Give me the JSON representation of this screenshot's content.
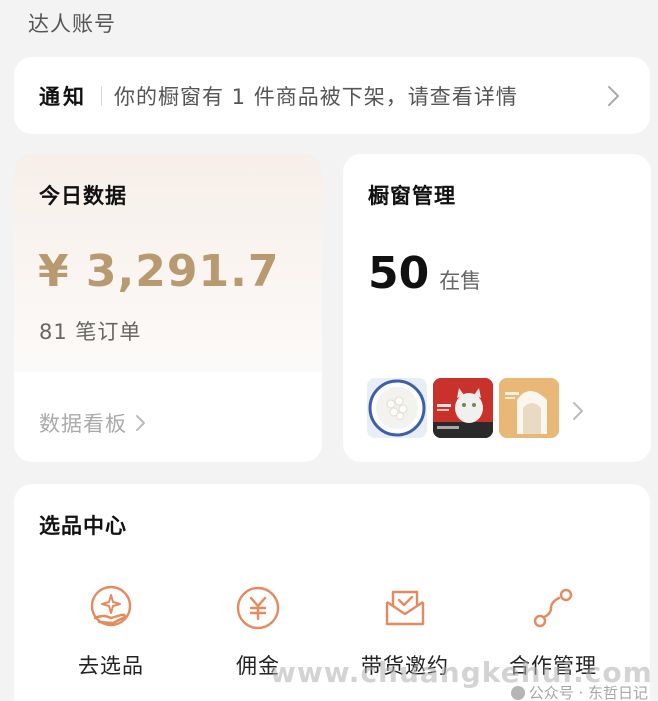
{
  "account": {
    "label": "达人账号"
  },
  "notice": {
    "tag": "通知",
    "text": "你的橱窗有 1 件商品被下架，请查看详情",
    "chevron_icon": "chevron-right-icon"
  },
  "today": {
    "title": "今日数据",
    "amount": "¥ 3,291.7",
    "orders": "81 笔订单",
    "dashboard_link": "数据看板",
    "accent_color": "#b89a71"
  },
  "window": {
    "title": "橱窗管理",
    "count": "50",
    "unit": "在售",
    "thumbnails": [
      "product-thumb-bowl",
      "product-thumb-cat-food",
      "product-thumb-cat-litter"
    ]
  },
  "selection": {
    "title": "选品中心",
    "tools": [
      {
        "label": "去选品",
        "icon": "hand-star-icon"
      },
      {
        "label": "佣金",
        "icon": "yen-coin-icon"
      },
      {
        "label": "带货邀约",
        "icon": "envelope-check-icon"
      },
      {
        "label": "合作管理",
        "icon": "connection-nodes-icon"
      }
    ],
    "icon_color": "#e58a5c"
  },
  "watermark": {
    "url": "www.chuangkehui.com",
    "account": "公众号 · 东哲日记"
  }
}
